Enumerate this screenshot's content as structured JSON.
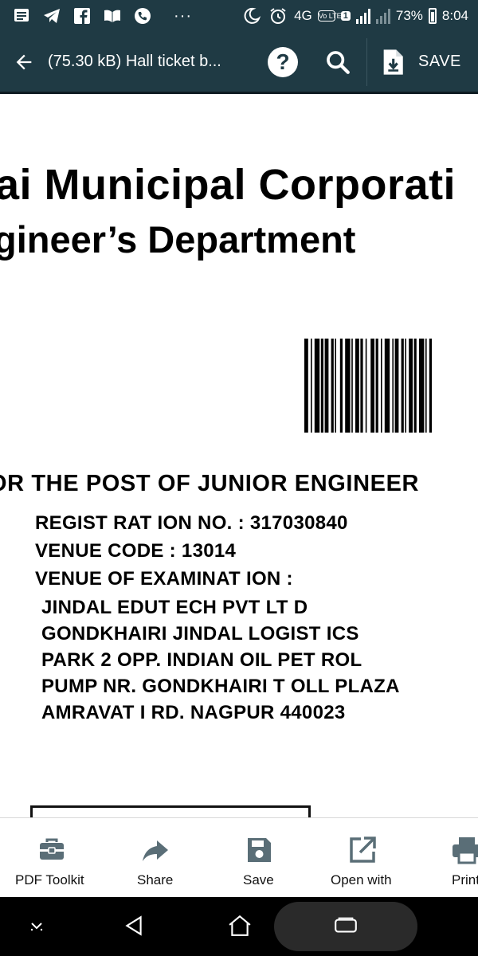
{
  "status_bar": {
    "network_type": "4G",
    "volte_label": "Vo LTE",
    "sim_badge": "1",
    "battery_percent": "73%",
    "time": "8:04",
    "colors": {
      "background": "#1f3a44",
      "foreground": "#ffffff"
    }
  },
  "app_bar": {
    "title": "(75.30 kB) Hall ticket b...",
    "help_label": "?",
    "save_label": "SAVE",
    "colors": {
      "background": "#1f3a44",
      "foreground": "#ffffff"
    }
  },
  "document": {
    "heading_line_1": "ai Municipal Corporati",
    "heading_line_2": "gineer’s Department",
    "post_line": "OR THE POST OF  JUNIOR ENGINEER",
    "registration_line": "REGIST RAT ION NO. : 317030840",
    "venue_code_line": "VENUE CODE : 13014",
    "venue_heading": "VENUE OF EXAMINAT ION :",
    "venue_lines": [
      "JINDAL EDUT ECH PVT  LT D",
      "GONDKHAIRI JINDAL LOGIST ICS",
      "PARK 2 OPP. INDIAN OIL PET ROL",
      "PUMP NR. GONDKHAIRI T OLL PLAZA",
      "AMRAVAT I RD. NAGPUR 440023"
    ]
  },
  "toolbar": {
    "items": [
      {
        "label": "PDF Toolkit",
        "icon": "toolkit-icon"
      },
      {
        "label": "Share",
        "icon": "share-arrow-icon"
      },
      {
        "label": "Save",
        "icon": "floppy-disk-icon"
      },
      {
        "label": "Open with",
        "icon": "open-external-icon"
      },
      {
        "label": "Print",
        "icon": "printer-icon"
      }
    ],
    "icon_color": "#5a6e77"
  },
  "nav_bar": {
    "buttons": [
      "hide-keyboard-icon",
      "back-triangle-icon",
      "home-icon",
      "recents-icon"
    ]
  }
}
